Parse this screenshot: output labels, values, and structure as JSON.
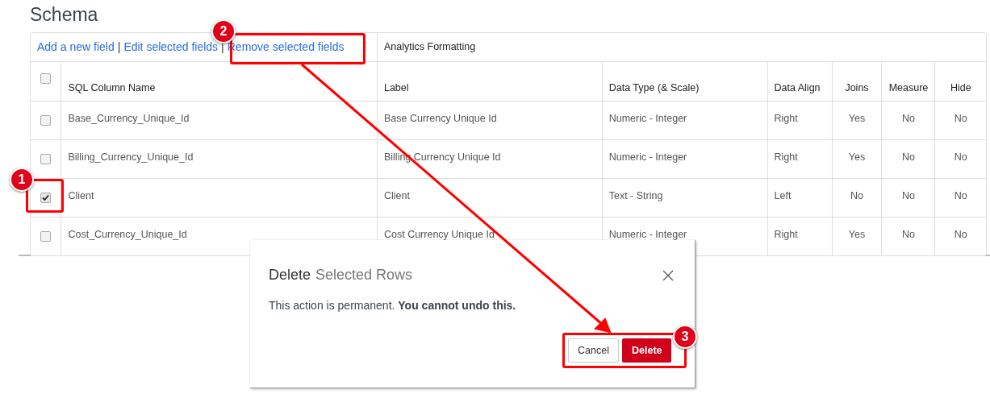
{
  "page": {
    "title": "Schema"
  },
  "toolbar": {
    "links": [
      "Add a new field",
      "Edit selected fields",
      "Remove selected fields"
    ],
    "separator": "|",
    "section_label": "Analytics Formatting"
  },
  "table": {
    "header_checked": false,
    "columns": [
      "SQL Column Name",
      "Label",
      "Data Type (& Scale)",
      "Data Align",
      "Joins",
      "Measure",
      "Hide"
    ],
    "rows": [
      {
        "checked": false,
        "cells": [
          "Base_Currency_Unique_Id",
          "Base Currency Unique Id",
          "Numeric - Integer",
          "Right",
          "Yes",
          "No",
          "No"
        ]
      },
      {
        "checked": false,
        "cells": [
          "Billing_Currency_Unique_Id",
          "Billing Currency Unique Id",
          "Numeric - Integer",
          "Right",
          "Yes",
          "No",
          "No"
        ]
      },
      {
        "checked": true,
        "cells": [
          "Client",
          "Client",
          "Text - String",
          "Left",
          "No",
          "No",
          "No"
        ]
      },
      {
        "checked": false,
        "cells": [
          "Cost_Currency_Unique_Id",
          "Cost Currency Unique Id",
          "Numeric - Integer",
          "Right",
          "Yes",
          "No",
          "No"
        ]
      }
    ]
  },
  "dialog": {
    "title": "Delete",
    "title_rest": "Selected Rows",
    "message": "This action is permanent. **You cannot undo this.**",
    "buttons": [
      {
        "label": "Cancel",
        "kind": "secondary"
      },
      {
        "label": "Delete",
        "kind": "danger"
      }
    ]
  },
  "callouts": [
    "1",
    "2",
    "3"
  ]
}
